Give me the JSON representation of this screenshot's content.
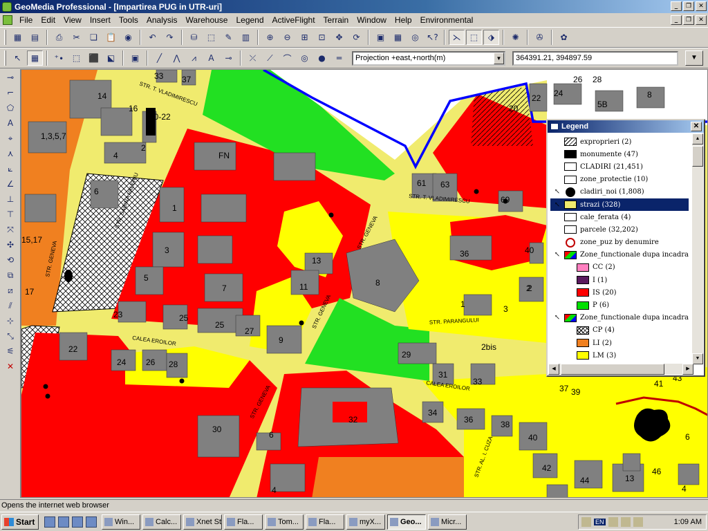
{
  "window": {
    "title": "GeoMedia Professional - [Impartirea PUG in UTR-uri]"
  },
  "menu": [
    "File",
    "Edit",
    "View",
    "Insert",
    "Tools",
    "Analysis",
    "Warehouse",
    "Legend",
    "ActiveFlight",
    "Terrain",
    "Window",
    "Help",
    "Environmental"
  ],
  "toolbar2": {
    "projection_value": "Projection +east,+north(m)",
    "coordinate_value": "364391.21, 394897.59"
  },
  "map": {
    "streets": [
      "STR. T. VLADIMIRESCU",
      "STR. GENEVA",
      "STR. GENEVA",
      "CALEA EROILOR",
      "CALEA EROILOR",
      "STR. PARANGULUI",
      "STR. T. VLADIMIRESCU",
      "STR. GENEVA",
      "STR. GENEVA",
      "STR. SABINA VALERIU",
      "STR. AL. I. CUZA"
    ],
    "numbers": [
      "33",
      "37",
      "14",
      "16",
      "20-22",
      "1,3,5,7",
      "2",
      "4",
      "FN",
      "6",
      "1",
      "3",
      "5",
      "15,17",
      "17",
      "7",
      "23",
      "25",
      "25",
      "27",
      "13",
      "11",
      "9",
      "8",
      "22",
      "24",
      "26",
      "28",
      "29",
      "30",
      "32",
      "34",
      "36",
      "38",
      "40",
      "42",
      "44",
      "4",
      "6",
      "31",
      "33",
      "2bis",
      "1",
      "3",
      "36",
      "40",
      "2",
      "61",
      "63",
      "69",
      "20",
      "22",
      "24",
      "26",
      "28",
      "5B",
      "8",
      "37",
      "39",
      "41",
      "43",
      "46",
      "13",
      "4",
      "6",
      "2"
    ]
  },
  "legend": {
    "title": "Legend",
    "close_label": "✕",
    "entries": [
      {
        "label": "exproprieri  (2)",
        "swatch": "hatch"
      },
      {
        "label": "monumente  (47)",
        "swatch": "#000000"
      },
      {
        "label": "CLADIRI  (21,451)",
        "swatch": "#ffffff"
      },
      {
        "label": "zone_protectie  (10)",
        "swatch": "#ffffff"
      },
      {
        "label": "cladiri_noi  (1,808)",
        "swatch": "blob"
      },
      {
        "label": "strazi  (328)",
        "swatch": "#f0eb6e",
        "selected": true
      },
      {
        "label": "cale_ferata  (4)",
        "swatch": "#ffffff"
      },
      {
        "label": "parcele  (32,202)",
        "swatch": "#ffffff"
      },
      {
        "label": "zone_puz by denumire",
        "swatch": "forbidden"
      },
      {
        "label": "Zone_functionale dupa incadra",
        "swatch": "multi"
      },
      {
        "label": "CC  (2)",
        "swatch": "#ff80c0",
        "indent": true
      },
      {
        "label": "I  (1)",
        "swatch": "#5a1a5e",
        "indent": true
      },
      {
        "label": "IS  (20)",
        "swatch": "#ff0000",
        "indent": true
      },
      {
        "label": "P  (6)",
        "swatch": "#00e000",
        "indent": true
      },
      {
        "label": "Zone_functionale dupa incadra",
        "swatch": "multi"
      },
      {
        "label": "CP  (4)",
        "swatch": "cross",
        "indent": true
      },
      {
        "label": "LI  (2)",
        "swatch": "#f08020",
        "indent": true
      },
      {
        "label": "LM  (3)",
        "swatch": "#ffff00",
        "indent": true
      }
    ]
  },
  "statusbar": {
    "text": "Opens the internet web browser"
  },
  "taskbar": {
    "start_label": "Start",
    "tasks": [
      "Win...",
      "Calc...",
      "Xnet St...",
      "Fla...",
      "Tom...",
      "Fla...",
      "myX...",
      "Geo...",
      "Micr..."
    ],
    "active_task": 7,
    "lang": "EN",
    "clock": "1:09 AM"
  },
  "colors": {
    "title_start": "#0a246a",
    "title_end": "#a6caf0",
    "zone_is_red": "#ff0000",
    "zone_lm_yellow": "#ffff00",
    "zone_p_green": "#00e000",
    "zone_li_orange": "#f08020",
    "street_yellow": "#f0eb6e",
    "building_gray": "#808080",
    "boundary_blue": "#0000ff"
  }
}
